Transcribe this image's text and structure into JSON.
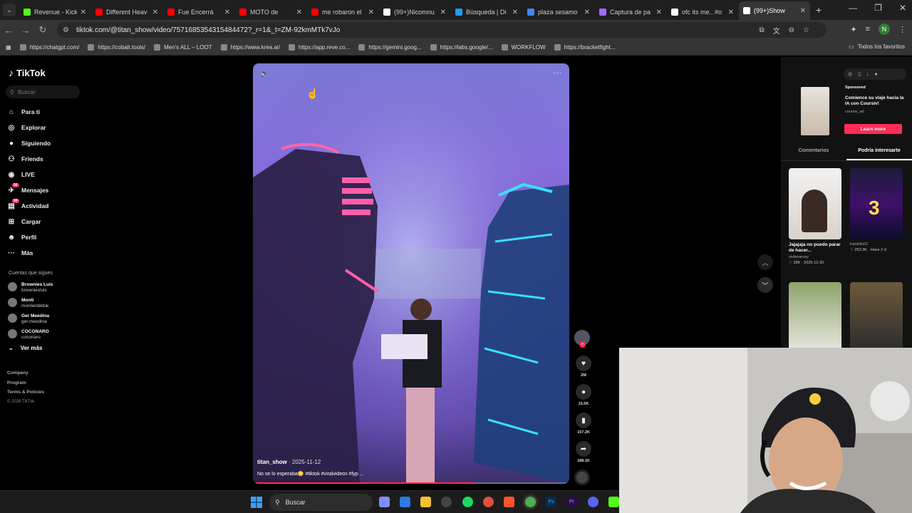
{
  "browser": {
    "tabs": [
      {
        "title": "Revenue - Kick",
        "color": "#53fc18",
        "active": false
      },
      {
        "title": "Different Heav",
        "color": "#ff0000",
        "active": false
      },
      {
        "title": "Fue Encerrá",
        "color": "#ff0000",
        "active": false
      },
      {
        "title": "MOTO de",
        "color": "#ff0000",
        "active": false
      },
      {
        "title": "me robaron el",
        "color": "#ff0000",
        "active": false
      },
      {
        "title": "(99+)Nicomnu",
        "color": "#ffffff",
        "active": false
      },
      {
        "title": "Búsqueda | Di",
        "color": "#1d9bf0",
        "active": false
      },
      {
        "title": "plaza sesamo",
        "color": "#4285f4",
        "active": false
      },
      {
        "title": "Captura de pa",
        "color": "#a569ff",
        "active": false
      },
      {
        "title": "ofc its me.. #o",
        "color": "#ffffff",
        "active": false
      },
      {
        "title": "(99+)Show",
        "color": "#ffffff",
        "active": true
      }
    ],
    "url": "tiktok.com/@titan_show/video/7571685354315484472?_r=1&_t=ZM-92kmMTk7vJo",
    "profile_initial": "N",
    "bookmarks": [
      "https://chatgpt.com/",
      "https://cobalt.tools/",
      "Men's ALL – LOOT",
      "https://www.krea.ai/",
      "https://app.reve.co...",
      "https://gemini.goog...",
      "https://labs.google/...",
      "WORKFLOW",
      "https://bracketfight..."
    ],
    "all_bookmarks": "Todos los favoritos"
  },
  "tiktok": {
    "logo": "TikTok",
    "search_placeholder": "Buscar",
    "nav": [
      {
        "label": "Para ti",
        "icon": "home-icon",
        "glyph": "⌂",
        "badge": ""
      },
      {
        "label": "Explorar",
        "icon": "compass-icon",
        "glyph": "◎",
        "badge": ""
      },
      {
        "label": "Siguiendo",
        "icon": "following-avatar-icon",
        "glyph": "●",
        "badge": ""
      },
      {
        "label": "Friends",
        "icon": "friends-icon",
        "glyph": "⚇",
        "badge": ""
      },
      {
        "label": "LIVE",
        "icon": "live-icon",
        "glyph": "◉",
        "badge": ""
      },
      {
        "label": "Mensajes",
        "icon": "messages-icon",
        "glyph": "✈",
        "badge": "56"
      },
      {
        "label": "Actividad",
        "icon": "activity-icon",
        "glyph": "▤",
        "badge": "99"
      },
      {
        "label": "Cargar",
        "icon": "upload-icon",
        "glyph": "⊞",
        "badge": ""
      },
      {
        "label": "Perfil",
        "icon": "profile-icon",
        "glyph": "☻",
        "badge": ""
      },
      {
        "label": "Más",
        "icon": "more-icon",
        "glyph": "···",
        "badge": ""
      }
    ],
    "following_title": "Cuentas que sigues",
    "following": [
      {
        "name": "Brownies Luis",
        "handle": "browniesluis"
      },
      {
        "name": "Monti",
        "handle": "montientiktok"
      },
      {
        "name": "Ger Meedina",
        "handle": "ger.meedina"
      },
      {
        "name": "COCONARO",
        "handle": "coconaro"
      }
    ],
    "ver_mas": "Ver más",
    "footer": [
      "Company",
      "Program",
      "Terms & Policies"
    ],
    "copyright": "© 2026 TikTok",
    "video": {
      "author": "titan_show",
      "date": "· 2025-11-12",
      "caption": "No se lo esperaba😳 #tiktok #viralvideos #fyp ...",
      "progress": 0.7
    },
    "actions": {
      "likes": "2M",
      "comments": "15.5K",
      "saves": "157.2K",
      "shares": "188.1K"
    },
    "sponsored": {
      "label": "Sponsored",
      "title": "Comience su viaje hacia la IA con Coursiv!",
      "handle": "coursiv_ad",
      "button": "Learn more"
    },
    "right_tabs": [
      "Comentarios",
      "Podría interesarte"
    ],
    "suggested": [
      {
        "caption": "Jajajaja no puedo parar de hacer...",
        "author": "violenarvay",
        "stats": "♡ 39K · 2025-12-30"
      },
      {
        "caption": "",
        "author": "frankillo02",
        "stats": "♡ 252.3K · Hace 2 d"
      }
    ]
  },
  "taskbar": {
    "search_label": "Buscar"
  }
}
